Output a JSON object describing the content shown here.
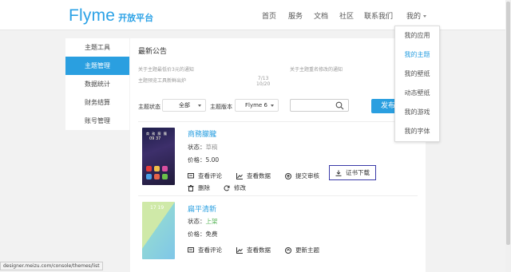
{
  "header": {
    "brand": "Flyme",
    "brand_sub": "开放平台",
    "nav": [
      "首页",
      "服务",
      "文档",
      "社区",
      "联系我们"
    ],
    "user_menu": "我的"
  },
  "sidebar": {
    "items": [
      {
        "label": "主题工具",
        "active": false
      },
      {
        "label": "主题管理",
        "active": true
      },
      {
        "label": "数据统计",
        "active": false
      },
      {
        "label": "财务结算",
        "active": false
      },
      {
        "label": "账号管理",
        "active": false
      }
    ]
  },
  "notice": {
    "title": "最新公告",
    "items": [
      "关于主题最低价3元的通知",
      "关于主题重名修改的通知",
      "主题预览工具新鲜出炉"
    ],
    "date": "7/13\n10/20"
  },
  "filters": {
    "status_label": "主题状态",
    "status_value": "全部",
    "version_label": "主题版本",
    "version_value": "Flyme 6",
    "search_value": "",
    "publish_label": "发布"
  },
  "themes": [
    {
      "name": "商務朦朧",
      "status_label": "状态：",
      "status": "草稿",
      "price_label": "价格：",
      "price": "5.00",
      "thumb_text": "商 務 朦 朧",
      "thumb_time": "09 37",
      "actions": [
        "查看评论",
        "查看数据",
        "提交审核",
        "证书下载",
        "删除",
        "修改"
      ]
    },
    {
      "name": "扁平清新",
      "status_label": "状态：",
      "status": "上架",
      "price_label": "价格：",
      "price": "免费",
      "thumb_time": "17 19",
      "actions": [
        "查看评论",
        "查看数据",
        "更新主题"
      ]
    }
  ],
  "user_dropdown": {
    "items": [
      {
        "label": "我的应用",
        "active": false
      },
      {
        "label": "我的主题",
        "active": true
      },
      {
        "label": "我的壁纸",
        "active": false
      },
      {
        "label": "动态壁纸",
        "active": false
      },
      {
        "label": "我的游戏",
        "active": false
      },
      {
        "label": "我的字体",
        "active": false
      }
    ]
  },
  "status_url": "designer.meizu.com/console/themes/list",
  "colors": {
    "accent": "#2a9fe0",
    "onshelf": "#5ab55a",
    "draft": "#999999",
    "highlight_border": "#3a3aa8"
  }
}
